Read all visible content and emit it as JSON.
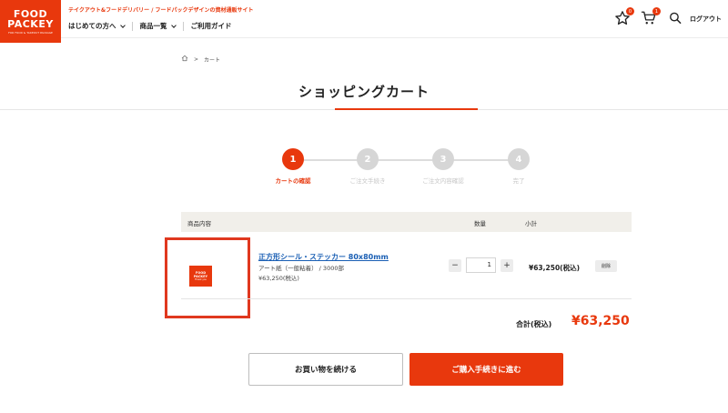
{
  "header": {
    "logo_line1": "FOOD",
    "logo_line2": "PACKEY",
    "logo_line3": "FOR FOOD & TAKEOUT PACKAGE",
    "tagline": "テイクアウト&フードデリバリー / フードパックデザインの資材通販サイト",
    "nav": [
      {
        "label": "はじめての方へ"
      },
      {
        "label": "商品一覧"
      },
      {
        "label": "ご利用ガイド"
      }
    ],
    "favorites_count": "0",
    "cart_count": "1",
    "logout_label": "ログアウト",
    "icons": [
      "star-icon",
      "cart-icon",
      "search-icon"
    ]
  },
  "breadcrumb": {
    "current": "カート"
  },
  "page_title": "ショッピングカート",
  "steps": [
    {
      "num": "1",
      "label": "カートの確認"
    },
    {
      "num": "2",
      "label": "ご注文手続き"
    },
    {
      "num": "3",
      "label": "ご注文内容確認"
    },
    {
      "num": "4",
      "label": "完了"
    }
  ],
  "table": {
    "col_item": "商品内容",
    "col_qty": "数量",
    "col_subtotal": "小計"
  },
  "item": {
    "thumb_line1": "FOOD",
    "thumb_line2": "PACKEY",
    "thumb_line3": "Thank you",
    "name": "正方形シール・ステッカー 80x80mm",
    "spec": "アート紙（一般粘着） / 3000部",
    "price": "¥63,250(税込)",
    "qty_minus": "−",
    "qty_value": "1",
    "qty_plus": "+",
    "subtotal": "¥63,250(税込)",
    "delete_label": "削除"
  },
  "total": {
    "label": "合計(税込)",
    "value": "¥63,250"
  },
  "buttons": {
    "continue": "お買い物を続ける",
    "checkout": "ご購入手続きに進む"
  },
  "colors": {
    "accent": "#e8380d",
    "link": "#1a5fb4",
    "header_band": "#f1efea"
  }
}
